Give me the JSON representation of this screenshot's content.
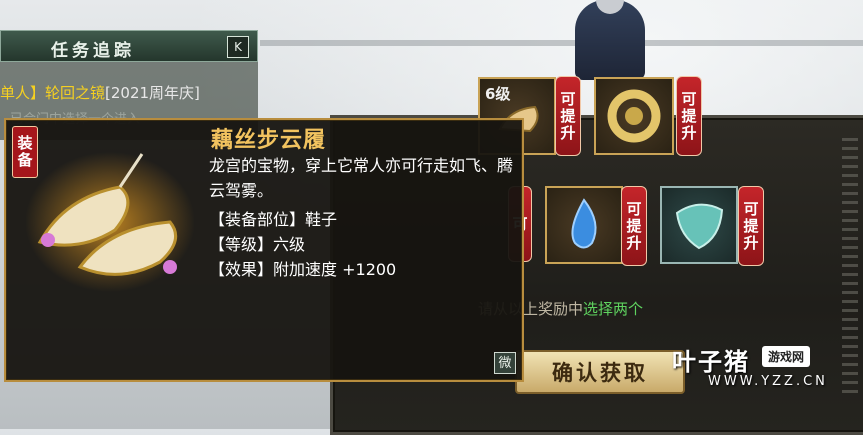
{
  "quest_tracker": {
    "title": "任务追踪",
    "toggle_icon": "collapse-icon",
    "quest_prefix": "单人】",
    "quest_name": "轮回之镜",
    "quest_tag": "[2021周年庆]",
    "faint_text": "已合门中选择一个进入"
  },
  "reward_panel": {
    "slots": [
      {
        "level": "6级",
        "badge": "可提升",
        "icon": "shoe-icon"
      },
      {
        "badge": "可提升",
        "icon": "jade-ring-icon"
      },
      {
        "badge": "可提升",
        "icon": "blue-flame-icon"
      },
      {
        "badge": "可提升",
        "icon": "jade-shield-icon"
      }
    ],
    "partial_badge": "可",
    "instruction_prefix": "请从以上奖励中",
    "instruction_highlight": "选择两个",
    "confirm_label": "确认获取"
  },
  "tooltip": {
    "badge": "装备",
    "item_name": "藕丝步云履",
    "description": "龙宫的宝物，穿上它常人亦可行走如飞、腾云驾雾。",
    "attributes": [
      {
        "label": "【装备部位】",
        "value": "鞋子"
      },
      {
        "label": "【等级】",
        "value": "六级"
      },
      {
        "label": "【效果】",
        "value": "附加速度 +1200"
      }
    ],
    "corner_icon_label": "微"
  },
  "watermark": {
    "main": "叶子猪",
    "tag": "游戏网",
    "url": "WWW.YZZ.CN"
  },
  "colors": {
    "gold": "#f2c35f",
    "badge_red": "#c4252a",
    "quest_yellow": "#f5d020",
    "highlight_green": "#5fd35f"
  }
}
